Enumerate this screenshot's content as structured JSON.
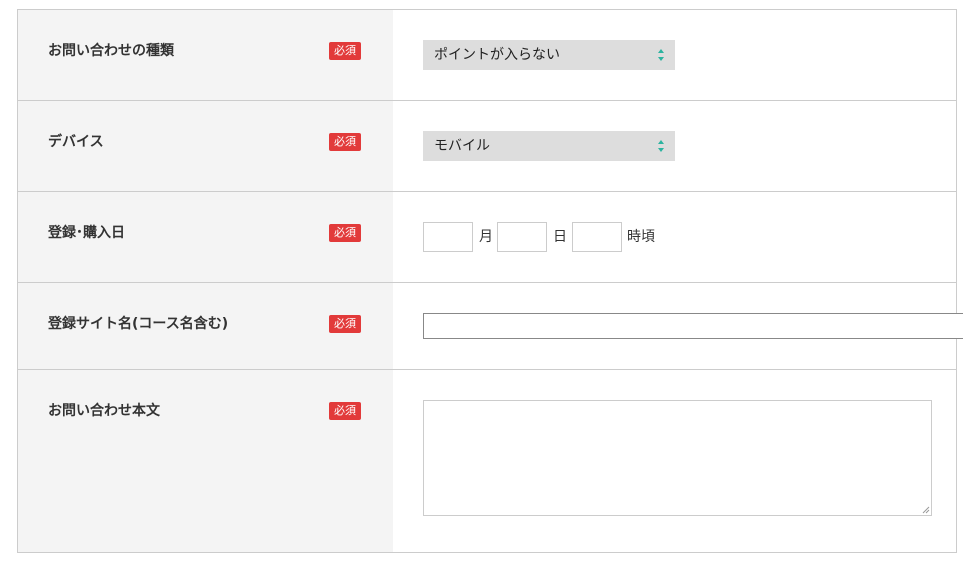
{
  "form": {
    "required_label": "必須",
    "inquiry_type": {
      "label": "お問い合わせの種類",
      "selected": "ポイントが入らない"
    },
    "device": {
      "label": "デバイス",
      "selected": "モバイル"
    },
    "registration_date": {
      "label": "登録･購入日",
      "month_unit": "月",
      "day_unit": "日",
      "hour_unit": "時頃",
      "month_value": "",
      "day_value": "",
      "hour_value": ""
    },
    "site_name": {
      "label": "登録サイト名(コース名含む)",
      "value": ""
    },
    "message": {
      "label": "お問い合わせ本文",
      "value": ""
    }
  },
  "colors": {
    "required_badge": "#e23a3a",
    "select_arrow": "#2bb3a0",
    "label_background": "#f4f4f4",
    "select_background": "#dddddd"
  },
  "icons": {
    "select_arrow": "up-down-arrows-icon",
    "resize_grip": "resize-grip-icon"
  }
}
